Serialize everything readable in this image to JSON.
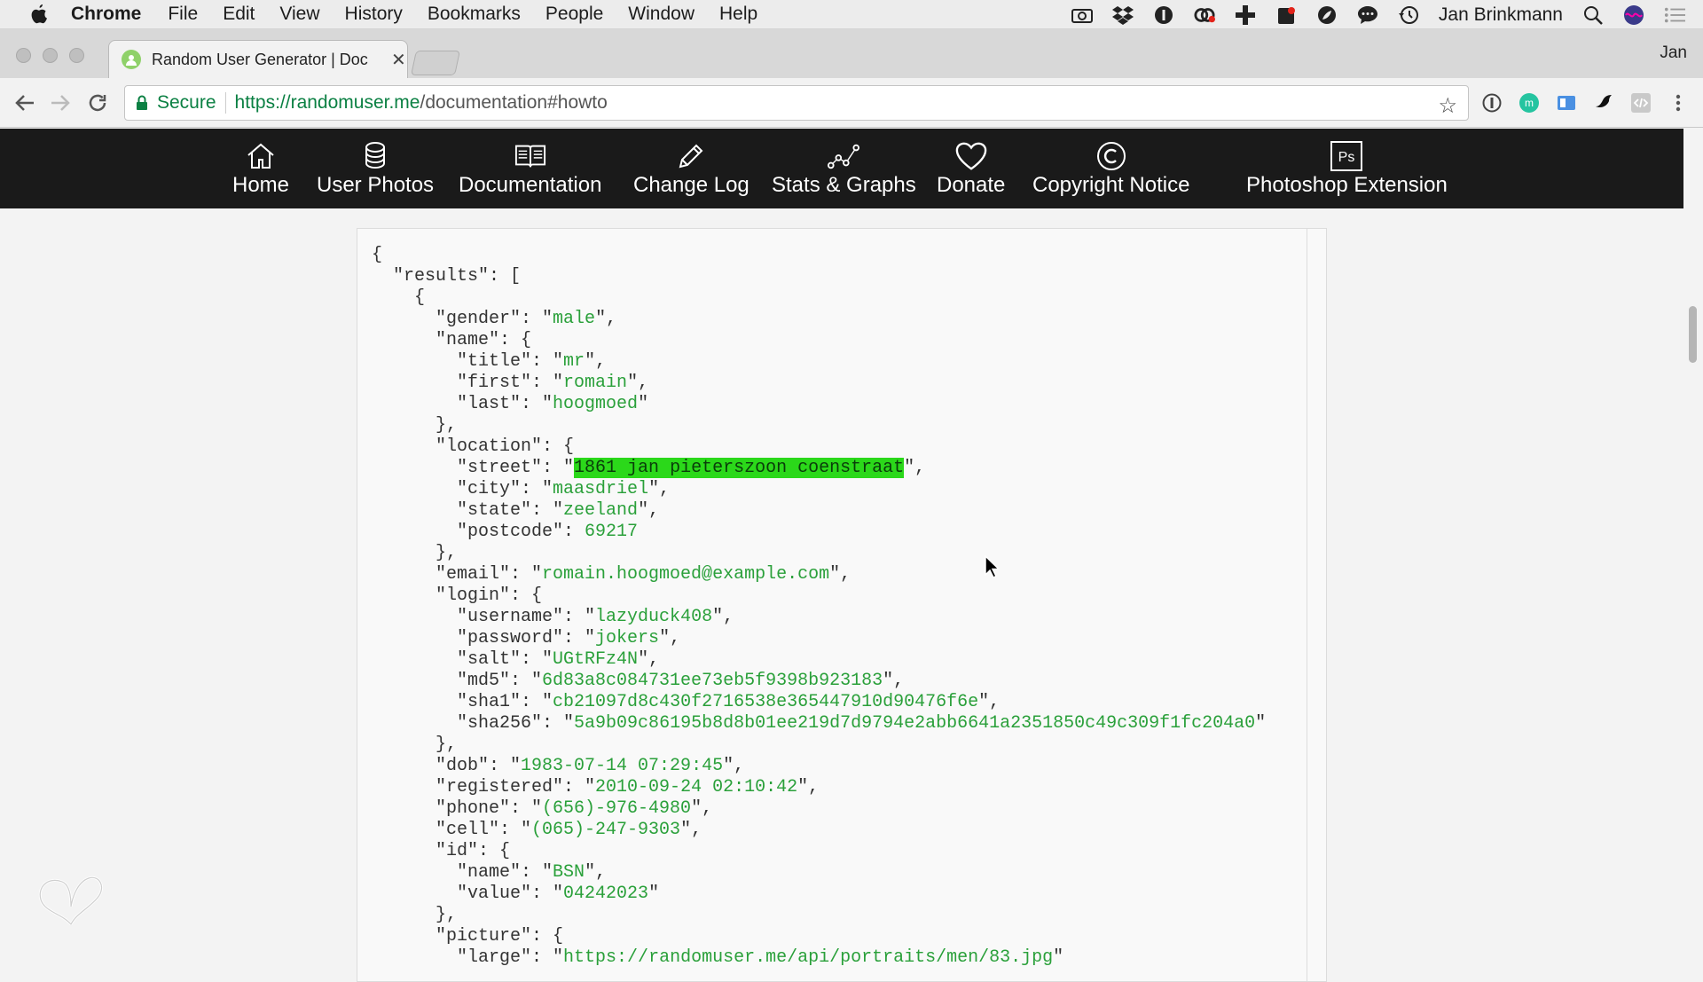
{
  "menubar": {
    "app": "Chrome",
    "items": [
      "File",
      "Edit",
      "View",
      "History",
      "Bookmarks",
      "People",
      "Window",
      "Help"
    ],
    "user": "Jan Brinkmann"
  },
  "tab": {
    "title": "Random User Generator | Doc",
    "profile": "Jan"
  },
  "omnibox": {
    "secure_label": "Secure",
    "url_host": "https://randomuser.me",
    "url_path": "/documentation#howto"
  },
  "sitenav": {
    "items": [
      {
        "label": "Home",
        "icon": "home-icon"
      },
      {
        "label": "User Photos",
        "icon": "user-photos-icon"
      },
      {
        "label": "Documentation",
        "icon": "book-icon"
      },
      {
        "label": "Change Log",
        "icon": "pencil-icon"
      },
      {
        "label": "Stats & Graphs",
        "icon": "graph-icon"
      },
      {
        "label": "Donate",
        "icon": "heart-icon"
      },
      {
        "label": "Copyright Notice",
        "icon": "copyright-icon"
      },
      {
        "label": "Photoshop Extension",
        "icon": "photoshop-icon"
      }
    ]
  },
  "json_sample": {
    "gender": "male",
    "name_title": "mr",
    "name_first": "romain",
    "name_last": "hoogmoed",
    "street": "1861 jan pieterszoon coenstraat",
    "city": "maasdriel",
    "state": "zeeland",
    "postcode": "69217",
    "email": "romain.hoogmoed@example.com",
    "username": "lazyduck408",
    "password": "jokers",
    "salt": "UGtRFz4N",
    "md5": "6d83a8c084731ee73eb5f9398b923183",
    "sha1": "cb21097d8c430f2716538e365447910d90476f6e",
    "sha256": "5a9b09c86195b8d8b01ee219d7d9794e2abb6641a2351850c49c309f1fc204a0",
    "dob": "1983-07-14 07:29:45",
    "registered": "2010-09-24 02:10:42",
    "phone": "(656)-976-4980",
    "cell": "(065)-247-9303",
    "id_name": "BSN",
    "id_value": "04242023",
    "picture_large": "https://randomuser.me/api/portraits/men/83.jpg"
  },
  "colors": {
    "nav_bg": "#1a1a1a",
    "string": "#2aa03a",
    "highlight": "#2bd81a",
    "secure": "#0b8043"
  }
}
